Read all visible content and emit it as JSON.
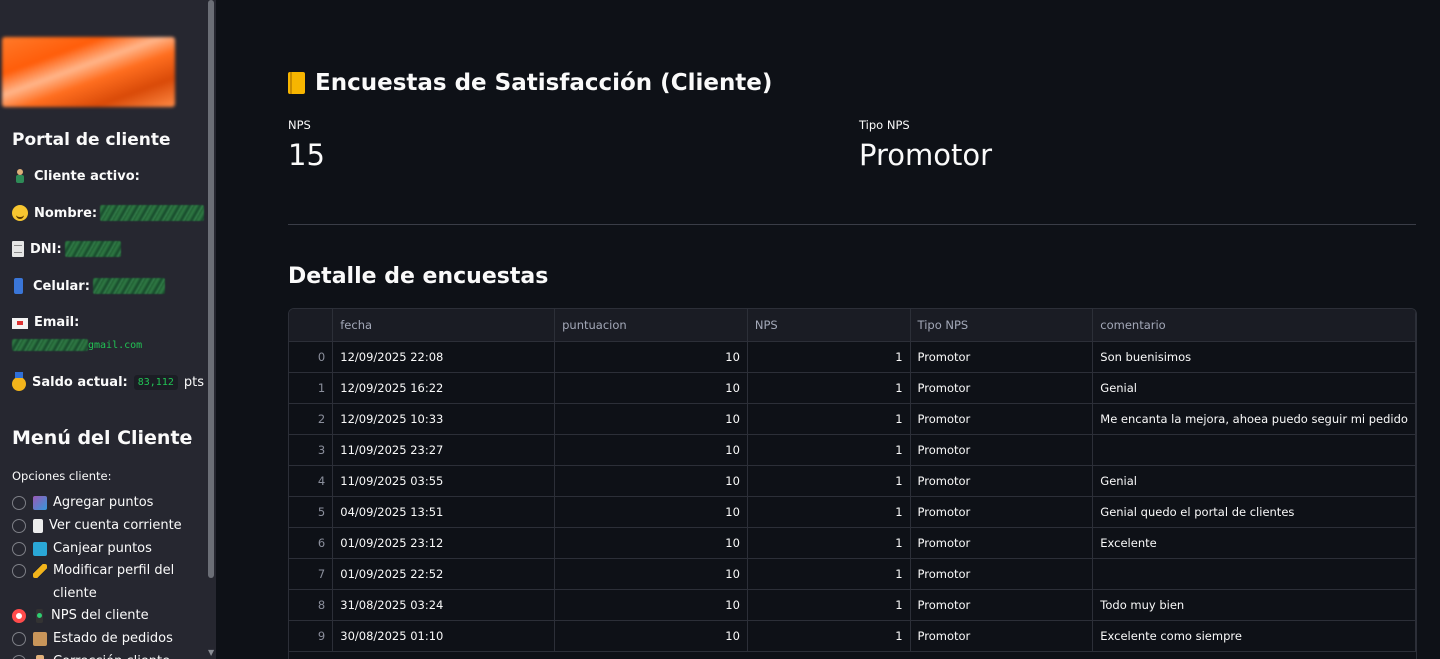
{
  "sidebar": {
    "portal_title": "Portal de cliente",
    "cliente_activo_label": "Cliente activo:",
    "nombre_label": "Nombre:",
    "dni_label": "DNI:",
    "celular_label": "Celular:",
    "email_label": "Email:",
    "email_domain": "gmail.com",
    "saldo_label": "Saldo actual:",
    "saldo_value": "83,112",
    "saldo_unit": "pts",
    "menu_title": "Menú del Cliente",
    "options_label": "Opciones cliente:",
    "options": [
      {
        "label": "Agregar puntos",
        "icon": "add-points-icon",
        "selected": false
      },
      {
        "label": "Ver cuenta corriente",
        "icon": "account-statement-icon",
        "selected": false
      },
      {
        "label": "Canjear puntos",
        "icon": "redeem-icon",
        "selected": false
      },
      {
        "label": "Modificar perfil del cliente",
        "icon": "pencil-icon",
        "selected": false
      },
      {
        "label": "NPS del cliente",
        "icon": "traffic-light-icon",
        "selected": true
      },
      {
        "label": "Estado de pedidos",
        "icon": "package-icon",
        "selected": false
      },
      {
        "label": "Corrección cliente",
        "icon": "person-icon",
        "selected": false
      }
    ]
  },
  "main": {
    "page_title": "Encuestas de Satisfacción (Cliente)",
    "metrics": [
      {
        "label": "NPS",
        "value": "15"
      },
      {
        "label": "Tipo NPS",
        "value": "Promotor"
      }
    ],
    "detail_title": "Detalle de encuestas",
    "table": {
      "columns": [
        "",
        "fecha",
        "puntuacion",
        "NPS",
        "Tipo NPS",
        "comentario"
      ],
      "rows": [
        {
          "idx": "0",
          "fecha": "12/09/2025 22:08",
          "puntuacion": "10",
          "nps": "1",
          "tipo": "Promotor",
          "comentario": "Son buenisimos"
        },
        {
          "idx": "1",
          "fecha": "12/09/2025 16:22",
          "puntuacion": "10",
          "nps": "1",
          "tipo": "Promotor",
          "comentario": "Genial"
        },
        {
          "idx": "2",
          "fecha": "12/09/2025 10:33",
          "puntuacion": "10",
          "nps": "1",
          "tipo": "Promotor",
          "comentario": "Me encanta la mejora, ahoea puedo seguir mi pedido"
        },
        {
          "idx": "3",
          "fecha": "11/09/2025 23:27",
          "puntuacion": "10",
          "nps": "1",
          "tipo": "Promotor",
          "comentario": ""
        },
        {
          "idx": "4",
          "fecha": "11/09/2025 03:55",
          "puntuacion": "10",
          "nps": "1",
          "tipo": "Promotor",
          "comentario": "Genial"
        },
        {
          "idx": "5",
          "fecha": "04/09/2025 13:51",
          "puntuacion": "10",
          "nps": "1",
          "tipo": "Promotor",
          "comentario": "Genial quedo el portal de clientes"
        },
        {
          "idx": "6",
          "fecha": "01/09/2025 23:12",
          "puntuacion": "10",
          "nps": "1",
          "tipo": "Promotor",
          "comentario": "Excelente"
        },
        {
          "idx": "7",
          "fecha": "01/09/2025 22:52",
          "puntuacion": "10",
          "nps": "1",
          "tipo": "Promotor",
          "comentario": ""
        },
        {
          "idx": "8",
          "fecha": "31/08/2025 03:24",
          "puntuacion": "10",
          "nps": "1",
          "tipo": "Promotor",
          "comentario": "Todo muy bien"
        },
        {
          "idx": "9",
          "fecha": "30/08/2025 01:10",
          "puntuacion": "10",
          "nps": "1",
          "tipo": "Promotor",
          "comentario": "Excelente como siempre"
        }
      ]
    }
  },
  "colors": {
    "background": "#0e1117",
    "sidebar": "#262730",
    "accent_radio": "#ff4b4b",
    "code_green": "#21c354"
  }
}
